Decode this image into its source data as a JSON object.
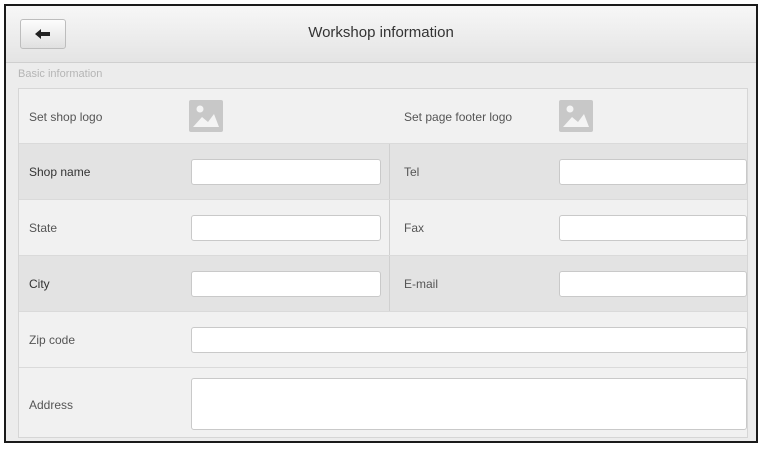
{
  "header": {
    "title": "Workshop information",
    "back_icon": "back-arrow-icon"
  },
  "section": {
    "label": "Basic information"
  },
  "logos": {
    "shop_logo_label": "Set shop logo",
    "footer_logo_label": "Set page footer logo",
    "icon": "image-placeholder-icon"
  },
  "fields": {
    "shop_name": {
      "label": "Shop name",
      "value": ""
    },
    "tel": {
      "label": "Tel",
      "value": ""
    },
    "state": {
      "label": "State",
      "value": ""
    },
    "fax": {
      "label": "Fax",
      "value": ""
    },
    "city": {
      "label": "City",
      "value": ""
    },
    "email": {
      "label": "E-mail",
      "value": ""
    },
    "zip": {
      "label": "Zip code",
      "value": ""
    },
    "address": {
      "label": "Address",
      "value": ""
    }
  }
}
